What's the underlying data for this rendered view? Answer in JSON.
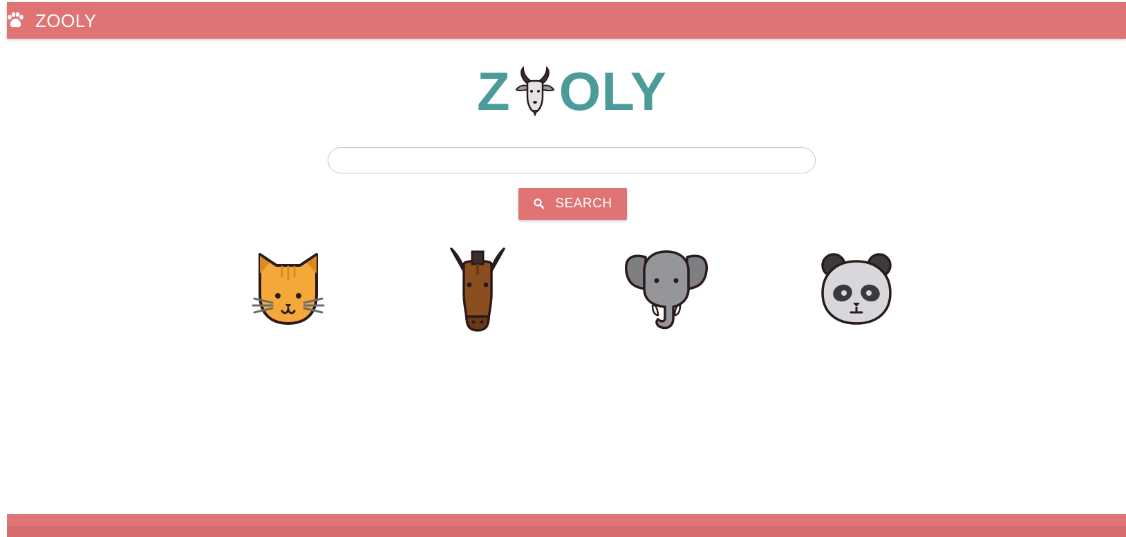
{
  "topbar": {
    "brand": "ZOOLY",
    "icon": "paw-icon"
  },
  "logo": {
    "letter_first": "Z",
    "icon": "goat-icon",
    "letters_rest": "OLY"
  },
  "search": {
    "value": "",
    "placeholder": "",
    "button_label": "SEARCH",
    "button_icon": "search-icon"
  },
  "animals": [
    {
      "name": "cat",
      "icon": "cat-icon"
    },
    {
      "name": "horse",
      "icon": "horse-icon"
    },
    {
      "name": "elephant",
      "icon": "elephant-icon"
    },
    {
      "name": "panda",
      "icon": "panda-icon"
    }
  ],
  "colors": {
    "primary": "#e07474",
    "logo": "#4b9b98",
    "cat": "#f4a83a",
    "horse": "#8b4f1f",
    "elephant": "#7e7f83",
    "panda": "#d8d8dc",
    "outline": "#2a1a1a"
  }
}
